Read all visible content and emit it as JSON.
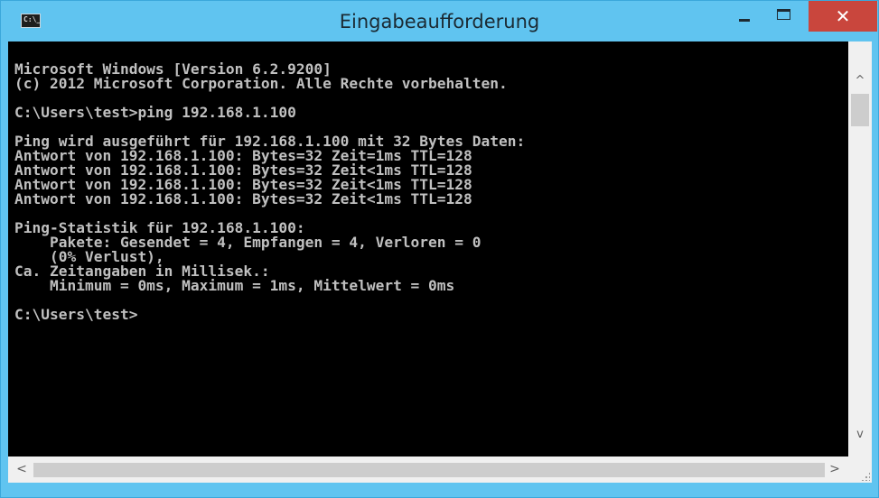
{
  "window": {
    "title": "Eingabeaufforderung",
    "icon_label": "C:\\_",
    "close_glyph": "✕",
    "accent_color": "#60c4f0",
    "close_color": "#c9463d"
  },
  "console": {
    "background": "#000000",
    "foreground": "#c0c0c0",
    "lines": [
      "Microsoft Windows [Version 6.2.9200]",
      "(c) 2012 Microsoft Corporation. Alle Rechte vorbehalten.",
      "",
      "C:\\Users\\test>ping 192.168.1.100",
      "",
      "Ping wird ausgeführt für 192.168.1.100 mit 32 Bytes Daten:",
      "Antwort von 192.168.1.100: Bytes=32 Zeit=1ms TTL=128",
      "Antwort von 192.168.1.100: Bytes=32 Zeit<1ms TTL=128",
      "Antwort von 192.168.1.100: Bytes=32 Zeit<1ms TTL=128",
      "Antwort von 192.168.1.100: Bytes=32 Zeit<1ms TTL=128",
      "",
      "Ping-Statistik für 192.168.1.100:",
      "    Pakete: Gesendet = 4, Empfangen = 4, Verloren = 0",
      "    (0% Verlust),",
      "Ca. Zeitangaben in Millisek.:",
      "    Minimum = 0ms, Maximum = 1ms, Mittelwert = 0ms",
      "",
      "C:\\Users\\test>"
    ]
  },
  "scrollbars": {
    "up_arrow": "^",
    "down_arrow": "v",
    "left_arrow": "<",
    "right_arrow": ">"
  }
}
